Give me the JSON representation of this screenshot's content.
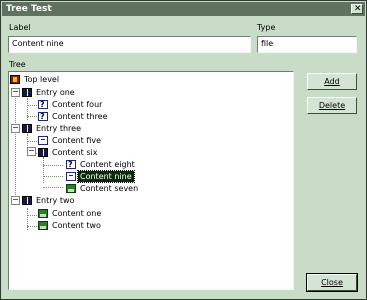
{
  "window": {
    "title": "Tree Test",
    "close_glyph": "✕"
  },
  "form": {
    "label_caption": "Label",
    "label_value": "Content nine",
    "type_caption": "Type",
    "type_value": "file",
    "tree_caption": "Tree"
  },
  "tree": {
    "nodes": [
      {
        "label": "Top level",
        "icon": "toplevel-icon"
      },
      {
        "label": "Entry one",
        "icon": "book-icon"
      },
      {
        "label": "Content four",
        "icon": "doc-help-icon"
      },
      {
        "label": "Content three",
        "icon": "doc-help-icon"
      },
      {
        "label": "Entry three",
        "icon": "book-icon"
      },
      {
        "label": "Content five",
        "icon": "doc-icon"
      },
      {
        "label": "Content six",
        "icon": "book-icon"
      },
      {
        "label": "Content eight",
        "icon": "doc-help-icon"
      },
      {
        "label": "Content nine",
        "icon": "doc-icon",
        "selected": true
      },
      {
        "label": "Content seven",
        "icon": "image-icon"
      },
      {
        "label": "Entry two",
        "icon": "book-icon"
      },
      {
        "label": "Content one",
        "icon": "image-icon"
      },
      {
        "label": "Content two",
        "icon": "image-icon"
      }
    ],
    "expand_glyph": "−"
  },
  "buttons": {
    "add": "Add",
    "delete": "Delete",
    "close": "Close"
  }
}
